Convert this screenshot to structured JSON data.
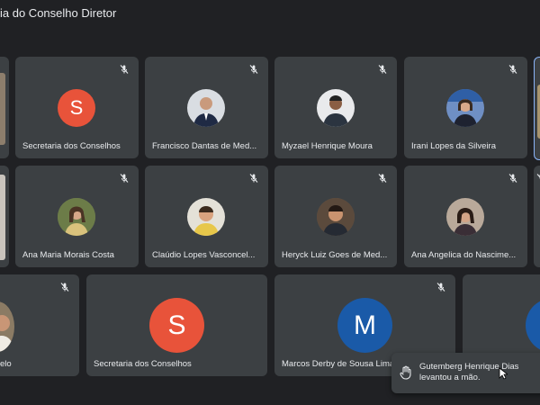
{
  "meeting": {
    "title": "ia do Conselho Diretor"
  },
  "row1": [
    {
      "name": "Secretaria dos Conselhos",
      "initial": "S",
      "avatar_color": "#e8533a"
    },
    {
      "name": "Francisco Dantas de Med..."
    },
    {
      "name": "Myzael Henrique Moura"
    },
    {
      "name": "Irani Lopes da Silveira"
    }
  ],
  "row2": [
    {
      "name": "Ana Maria Morais Costa"
    },
    {
      "name": "Claúdio Lopes Vasconcel..."
    },
    {
      "name": "Heryck Luiz Goes de Med..."
    },
    {
      "name": "Ana Angelica do Nascime..."
    }
  ],
  "row3": [
    {
      "name": "elo"
    },
    {
      "name": "Secretaria dos Conselhos",
      "initial": "S",
      "avatar_color": "#e8533a"
    },
    {
      "name": "Marcos Derby de Sousa Lima",
      "initial": "M",
      "avatar_color": "#1a5aa8"
    }
  ],
  "notification": {
    "text": "Gutemberg Henrique Dias levantou a mão."
  },
  "icons": {
    "muted": "mic-off-icon",
    "hand": "raise-hand-icon",
    "cursor": "mouse-cursor-icon"
  }
}
